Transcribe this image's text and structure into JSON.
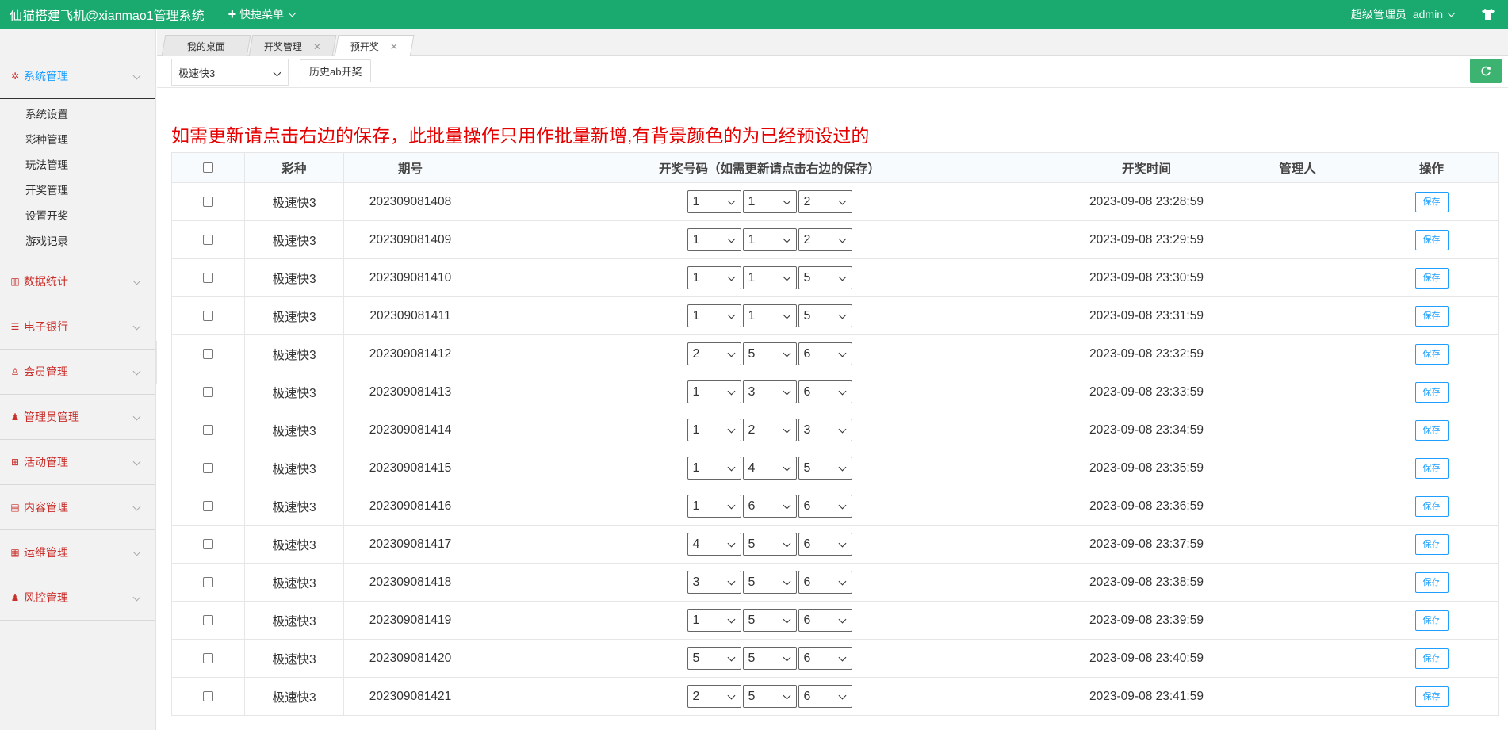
{
  "header": {
    "title": "仙猫搭建飞机@xianmao1管理系统",
    "quick_menu": "快捷菜单",
    "role": "超级管理员",
    "user": "admin"
  },
  "sidebar": {
    "groups": [
      {
        "label": "系统管理",
        "icon": "gear-icon",
        "expanded": true,
        "items": [
          "系统设置",
          "彩种管理",
          "玩法管理",
          "开奖管理",
          "设置开奖",
          "游戏记录"
        ]
      },
      {
        "label": "数据统计",
        "icon": "bar-chart-icon"
      },
      {
        "label": "电子银行",
        "icon": "list-icon"
      },
      {
        "label": "会员管理",
        "icon": "user-icon"
      },
      {
        "label": "管理员管理",
        "icon": "admin-user-icon"
      },
      {
        "label": "活动管理",
        "icon": "gift-icon"
      },
      {
        "label": "内容管理",
        "icon": "content-icon"
      },
      {
        "label": "运维管理",
        "icon": "server-icon"
      },
      {
        "label": "风控管理",
        "icon": "shield-user-icon"
      }
    ]
  },
  "tabs": [
    {
      "label": "我的桌面"
    },
    {
      "label": "开奖管理"
    },
    {
      "label": "预开奖"
    }
  ],
  "toolbar": {
    "game_select": "极速快3",
    "history_button": "历史ab开奖"
  },
  "notice": "如需更新请点击右边的保存，此批量操作只用作批量新增,有背景颜色的为已经预设过的",
  "table": {
    "headers": [
      "彩种",
      "期号",
      "开奖号码（如需更新请点击右边的保存）",
      "开奖时间",
      "管理人",
      "操作"
    ],
    "save_label": "保存",
    "rows": [
      {
        "game": "极速快3",
        "period": "202309081408",
        "n1": "1",
        "n2": "1",
        "n3": "2",
        "time": "2023-09-08 23:28:59",
        "admin": ""
      },
      {
        "game": "极速快3",
        "period": "202309081409",
        "n1": "1",
        "n2": "1",
        "n3": "2",
        "time": "2023-09-08 23:29:59",
        "admin": ""
      },
      {
        "game": "极速快3",
        "period": "202309081410",
        "n1": "1",
        "n2": "1",
        "n3": "5",
        "time": "2023-09-08 23:30:59",
        "admin": ""
      },
      {
        "game": "极速快3",
        "period": "202309081411",
        "n1": "1",
        "n2": "1",
        "n3": "5",
        "time": "2023-09-08 23:31:59",
        "admin": ""
      },
      {
        "game": "极速快3",
        "period": "202309081412",
        "n1": "2",
        "n2": "5",
        "n3": "6",
        "time": "2023-09-08 23:32:59",
        "admin": ""
      },
      {
        "game": "极速快3",
        "period": "202309081413",
        "n1": "1",
        "n2": "3",
        "n3": "6",
        "time": "2023-09-08 23:33:59",
        "admin": ""
      },
      {
        "game": "极速快3",
        "period": "202309081414",
        "n1": "1",
        "n2": "2",
        "n3": "3",
        "time": "2023-09-08 23:34:59",
        "admin": ""
      },
      {
        "game": "极速快3",
        "period": "202309081415",
        "n1": "1",
        "n2": "4",
        "n3": "5",
        "time": "2023-09-08 23:35:59",
        "admin": ""
      },
      {
        "game": "极速快3",
        "period": "202309081416",
        "n1": "1",
        "n2": "6",
        "n3": "6",
        "time": "2023-09-08 23:36:59",
        "admin": ""
      },
      {
        "game": "极速快3",
        "period": "202309081417",
        "n1": "4",
        "n2": "5",
        "n3": "6",
        "time": "2023-09-08 23:37:59",
        "admin": ""
      },
      {
        "game": "极速快3",
        "period": "202309081418",
        "n1": "3",
        "n2": "5",
        "n3": "6",
        "time": "2023-09-08 23:38:59",
        "admin": ""
      },
      {
        "game": "极速快3",
        "period": "202309081419",
        "n1": "1",
        "n2": "5",
        "n3": "6",
        "time": "2023-09-08 23:39:59",
        "admin": ""
      },
      {
        "game": "极速快3",
        "period": "202309081420",
        "n1": "5",
        "n2": "5",
        "n3": "6",
        "time": "2023-09-08 23:40:59",
        "admin": ""
      },
      {
        "game": "极速快3",
        "period": "202309081421",
        "n1": "2",
        "n2": "5",
        "n3": "6",
        "time": "2023-09-08 23:41:59",
        "admin": ""
      }
    ]
  },
  "colors": {
    "header_bg": "#1aaa6f",
    "accent": "#1e9fff",
    "notice": "#e60000",
    "sidebar_text": "#c9302c"
  }
}
